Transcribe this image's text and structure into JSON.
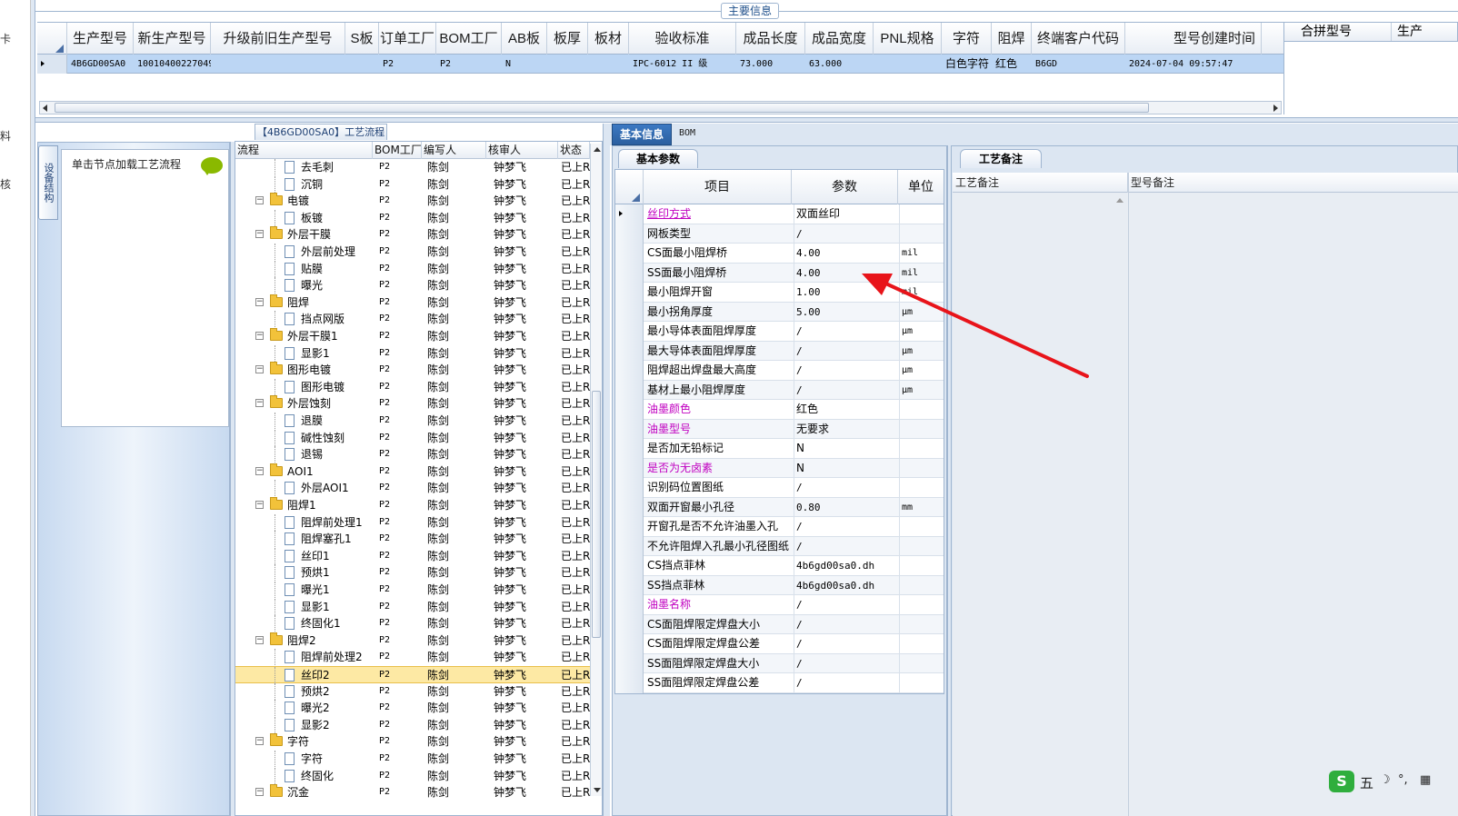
{
  "left_strip": [
    "卡",
    "料",
    "核"
  ],
  "top_panel": {
    "group_title": "主要信息",
    "columns": [
      "生产型号",
      "新生产型号",
      "升级前旧生产型号",
      "S板",
      "订单工厂",
      "BOM工厂",
      "AB板",
      "板厚",
      "板材",
      "验收标准",
      "成品长度",
      "成品宽度",
      "PNL规格",
      "字符",
      "阻焊",
      "终端客户代码",
      "型号创建时间"
    ],
    "row": {
      "生产型号": "4B6GD00SA0",
      "新生产型号": "10010400227049",
      "升级前旧生产型号": "",
      "S板": "",
      "订单工厂": "P2",
      "BOM工厂": "P2",
      "AB板": "N",
      "板厚": "",
      "板材": "",
      "验收标准": "IPC-6012 II 级",
      "成品长度": "73.000",
      "成品宽度": "63.000",
      "PNL规格": "",
      "字符": "白色字符",
      "阻焊": "红色",
      "终端客户代码": "B6GD",
      "型号创建时间": "2024-07-04 09:57:47"
    },
    "merge_columns": [
      "合拼型号",
      "生产"
    ]
  },
  "nav": {
    "vertical_tab": "设备结构",
    "tip": "单击节点加载工艺流程"
  },
  "process_tree": {
    "title": "【4B6GD00SA0】工艺流程",
    "columns": [
      "流程",
      "BOM工厂",
      "编写人",
      "核审人",
      "状态"
    ],
    "rows": [
      {
        "level": 2,
        "name": "去毛刺",
        "factory": "P2",
        "writer": "陈剑",
        "reviewer": "钟梦飞",
        "status": "已上R",
        "folder": false,
        "selected": false
      },
      {
        "level": 2,
        "name": "沉铜",
        "factory": "P2",
        "writer": "陈剑",
        "reviewer": "钟梦飞",
        "status": "已上R",
        "folder": false,
        "selected": false
      },
      {
        "level": 1,
        "name": "电镀",
        "factory": "P2",
        "writer": "陈剑",
        "reviewer": "钟梦飞",
        "status": "已上R",
        "folder": true,
        "selected": false
      },
      {
        "level": 2,
        "name": "板镀",
        "factory": "P2",
        "writer": "陈剑",
        "reviewer": "钟梦飞",
        "status": "已上R",
        "folder": false,
        "selected": false
      },
      {
        "level": 1,
        "name": "外层干膜",
        "factory": "P2",
        "writer": "陈剑",
        "reviewer": "钟梦飞",
        "status": "已上R",
        "folder": true,
        "selected": false
      },
      {
        "level": 2,
        "name": "外层前处理",
        "factory": "P2",
        "writer": "陈剑",
        "reviewer": "钟梦飞",
        "status": "已上R",
        "folder": false,
        "selected": false
      },
      {
        "level": 2,
        "name": "贴膜",
        "factory": "P2",
        "writer": "陈剑",
        "reviewer": "钟梦飞",
        "status": "已上R",
        "folder": false,
        "selected": false
      },
      {
        "level": 2,
        "name": "曝光",
        "factory": "P2",
        "writer": "陈剑",
        "reviewer": "钟梦飞",
        "status": "已上R",
        "folder": false,
        "selected": false
      },
      {
        "level": 1,
        "name": "阻焊",
        "factory": "P2",
        "writer": "陈剑",
        "reviewer": "钟梦飞",
        "status": "已上R",
        "folder": true,
        "selected": false
      },
      {
        "level": 2,
        "name": "挡点网版",
        "factory": "P2",
        "writer": "陈剑",
        "reviewer": "钟梦飞",
        "status": "已上R",
        "folder": false,
        "selected": false
      },
      {
        "level": 1,
        "name": "外层干膜1",
        "factory": "P2",
        "writer": "陈剑",
        "reviewer": "钟梦飞",
        "status": "已上R",
        "folder": true,
        "selected": false
      },
      {
        "level": 2,
        "name": "显影1",
        "factory": "P2",
        "writer": "陈剑",
        "reviewer": "钟梦飞",
        "status": "已上R",
        "folder": false,
        "selected": false
      },
      {
        "level": 1,
        "name": "图形电镀",
        "factory": "P2",
        "writer": "陈剑",
        "reviewer": "钟梦飞",
        "status": "已上R",
        "folder": true,
        "selected": false
      },
      {
        "level": 2,
        "name": "图形电镀",
        "factory": "P2",
        "writer": "陈剑",
        "reviewer": "钟梦飞",
        "status": "已上R",
        "folder": false,
        "selected": false
      },
      {
        "level": 1,
        "name": "外层蚀刻",
        "factory": "P2",
        "writer": "陈剑",
        "reviewer": "钟梦飞",
        "status": "已上R",
        "folder": true,
        "selected": false
      },
      {
        "level": 2,
        "name": "退膜",
        "factory": "P2",
        "writer": "陈剑",
        "reviewer": "钟梦飞",
        "status": "已上R",
        "folder": false,
        "selected": false
      },
      {
        "level": 2,
        "name": "碱性蚀刻",
        "factory": "P2",
        "writer": "陈剑",
        "reviewer": "钟梦飞",
        "status": "已上R",
        "folder": false,
        "selected": false
      },
      {
        "level": 2,
        "name": "退锡",
        "factory": "P2",
        "writer": "陈剑",
        "reviewer": "钟梦飞",
        "status": "已上R",
        "folder": false,
        "selected": false
      },
      {
        "level": 1,
        "name": "AOI1",
        "factory": "P2",
        "writer": "陈剑",
        "reviewer": "钟梦飞",
        "status": "已上R",
        "folder": true,
        "selected": false
      },
      {
        "level": 2,
        "name": "外层AOI1",
        "factory": "P2",
        "writer": "陈剑",
        "reviewer": "钟梦飞",
        "status": "已上R",
        "folder": false,
        "selected": false
      },
      {
        "level": 1,
        "name": "阻焊1",
        "factory": "P2",
        "writer": "陈剑",
        "reviewer": "钟梦飞",
        "status": "已上R",
        "folder": true,
        "selected": false
      },
      {
        "level": 2,
        "name": "阻焊前处理1",
        "factory": "P2",
        "writer": "陈剑",
        "reviewer": "钟梦飞",
        "status": "已上R",
        "folder": false,
        "selected": false
      },
      {
        "level": 2,
        "name": "阻焊塞孔1",
        "factory": "P2",
        "writer": "陈剑",
        "reviewer": "钟梦飞",
        "status": "已上R",
        "folder": false,
        "selected": false
      },
      {
        "level": 2,
        "name": "丝印1",
        "factory": "P2",
        "writer": "陈剑",
        "reviewer": "钟梦飞",
        "status": "已上R",
        "folder": false,
        "selected": false
      },
      {
        "level": 2,
        "name": "预烘1",
        "factory": "P2",
        "writer": "陈剑",
        "reviewer": "钟梦飞",
        "status": "已上R",
        "folder": false,
        "selected": false
      },
      {
        "level": 2,
        "name": "曝光1",
        "factory": "P2",
        "writer": "陈剑",
        "reviewer": "钟梦飞",
        "status": "已上R",
        "folder": false,
        "selected": false
      },
      {
        "level": 2,
        "name": "显影1",
        "factory": "P2",
        "writer": "陈剑",
        "reviewer": "钟梦飞",
        "status": "已上R",
        "folder": false,
        "selected": false
      },
      {
        "level": 2,
        "name": "终固化1",
        "factory": "P2",
        "writer": "陈剑",
        "reviewer": "钟梦飞",
        "status": "已上R",
        "folder": false,
        "selected": false
      },
      {
        "level": 1,
        "name": "阻焊2",
        "factory": "P2",
        "writer": "陈剑",
        "reviewer": "钟梦飞",
        "status": "已上R",
        "folder": true,
        "selected": false
      },
      {
        "level": 2,
        "name": "阻焊前处理2",
        "factory": "P2",
        "writer": "陈剑",
        "reviewer": "钟梦飞",
        "status": "已上R",
        "folder": false,
        "selected": false
      },
      {
        "level": 2,
        "name": "丝印2",
        "factory": "P2",
        "writer": "陈剑",
        "reviewer": "钟梦飞",
        "status": "已上R",
        "folder": false,
        "selected": true
      },
      {
        "level": 2,
        "name": "预烘2",
        "factory": "P2",
        "writer": "陈剑",
        "reviewer": "钟梦飞",
        "status": "已上R",
        "folder": false,
        "selected": false
      },
      {
        "level": 2,
        "name": "曝光2",
        "factory": "P2",
        "writer": "陈剑",
        "reviewer": "钟梦飞",
        "status": "已上R",
        "folder": false,
        "selected": false
      },
      {
        "level": 2,
        "name": "显影2",
        "factory": "P2",
        "writer": "陈剑",
        "reviewer": "钟梦飞",
        "status": "已上R",
        "folder": false,
        "selected": false
      },
      {
        "level": 1,
        "name": "字符",
        "factory": "P2",
        "writer": "陈剑",
        "reviewer": "钟梦飞",
        "status": "已上R",
        "folder": true,
        "selected": false
      },
      {
        "level": 2,
        "name": "字符",
        "factory": "P2",
        "writer": "陈剑",
        "reviewer": "钟梦飞",
        "status": "已上R",
        "folder": false,
        "selected": false
      },
      {
        "level": 2,
        "name": "终固化",
        "factory": "P2",
        "writer": "陈剑",
        "reviewer": "钟梦飞",
        "status": "已上R",
        "folder": false,
        "selected": false
      },
      {
        "level": 1,
        "name": "沉金",
        "factory": "P2",
        "writer": "陈剑",
        "reviewer": "钟梦飞",
        "status": "已上R",
        "folder": true,
        "selected": false
      }
    ]
  },
  "info_panel": {
    "tabs": [
      "基本信息",
      "BOM"
    ],
    "sub_tab": "基本参数",
    "columns": [
      "项目",
      "参数",
      "单位"
    ],
    "rows": [
      {
        "item": "丝印方式",
        "value": "双面丝印",
        "unit": "",
        "style": "sel"
      },
      {
        "item": "网板类型",
        "value": "/",
        "unit": "",
        "style": ""
      },
      {
        "item": "CS面最小阻焊桥",
        "value": "4.00",
        "unit": "mil",
        "style": ""
      },
      {
        "item": "SS面最小阻焊桥",
        "value": "4.00",
        "unit": "mil",
        "style": ""
      },
      {
        "item": "最小阻焊开窗",
        "value": "1.00",
        "unit": "mil",
        "style": ""
      },
      {
        "item": "最小拐角厚度",
        "value": "5.00",
        "unit": "μm",
        "style": ""
      },
      {
        "item": "最小导体表面阻焊厚度",
        "value": "/",
        "unit": "μm",
        "style": ""
      },
      {
        "item": "最大导体表面阻焊厚度",
        "value": "/",
        "unit": "μm",
        "style": ""
      },
      {
        "item": "阻焊超出焊盘最大高度",
        "value": "/",
        "unit": "μm",
        "style": ""
      },
      {
        "item": "基材上最小阻焊厚度",
        "value": "/",
        "unit": "μm",
        "style": ""
      },
      {
        "item": "油墨颜色",
        "value": "红色",
        "unit": "",
        "style": "mag"
      },
      {
        "item": "油墨型号",
        "value": "无要求",
        "unit": "",
        "style": "mag"
      },
      {
        "item": "是否加无铅标记",
        "value": "N",
        "unit": "",
        "style": ""
      },
      {
        "item": "是否为无卤素",
        "value": "N",
        "unit": "",
        "style": "mag"
      },
      {
        "item": "识别码位置图纸",
        "value": "/",
        "unit": "",
        "style": ""
      },
      {
        "item": "双面开窗最小孔径",
        "value": "0.80",
        "unit": "mm",
        "style": ""
      },
      {
        "item": "开窗孔是否不允许油墨入孔",
        "value": "/",
        "unit": "",
        "style": ""
      },
      {
        "item": "不允许阻焊入孔最小孔径图纸",
        "value": "/",
        "unit": "",
        "style": ""
      },
      {
        "item": "CS挡点菲林",
        "value": "4b6gd00sa0.dh",
        "unit": "",
        "style": ""
      },
      {
        "item": "SS挡点菲林",
        "value": "4b6gd00sa0.dh",
        "unit": "",
        "style": ""
      },
      {
        "item": "油墨名称",
        "value": "/",
        "unit": "",
        "style": "mag"
      },
      {
        "item": "CS面阻焊限定焊盘大小",
        "value": "/",
        "unit": "",
        "style": ""
      },
      {
        "item": "CS面阻焊限定焊盘公差",
        "value": "/",
        "unit": "",
        "style": ""
      },
      {
        "item": "SS面阻焊限定焊盘大小",
        "value": "/",
        "unit": "",
        "style": ""
      },
      {
        "item": "SS面阻焊限定焊盘公差",
        "value": "/",
        "unit": "",
        "style": ""
      }
    ]
  },
  "remarks": {
    "tab": "工艺备注",
    "columns": [
      "工艺备注",
      "型号备注"
    ]
  },
  "ime": {
    "label": "五"
  },
  "colors": {
    "accent": "#2b5f9f",
    "selected_row": "#bcd6f4",
    "tree_selected": "#fde9a4",
    "magenta": "#c000c0",
    "arrow": "#e8141a"
  }
}
